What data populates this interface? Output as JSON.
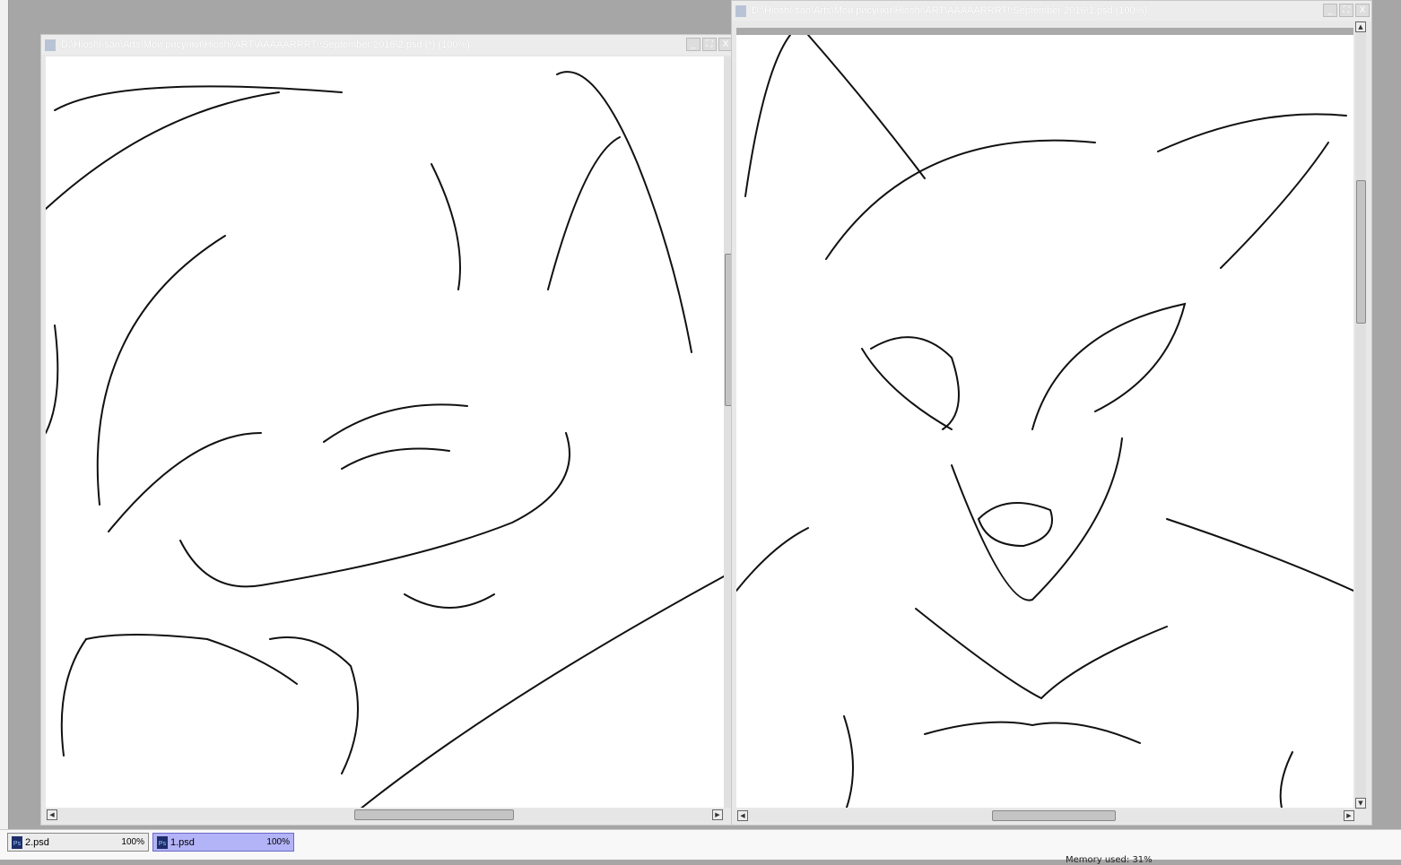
{
  "windows": [
    {
      "title": "D:\\Hioshi-san\\Arts\\Мои рисунки\\Hioshi\\ART\\AAAAARRRT!\\September 2016\\2.psd (*) (100%)"
    },
    {
      "title": "D:\\Hioshi-san\\Arts\\Мои рисунки\\Hioshi\\ART\\AAAAARRRT!\\September 2016\\1.psd (100%)"
    }
  ],
  "window_buttons": {
    "minimize": "_",
    "maximize": "⛶",
    "close": "X"
  },
  "taskbar": {
    "tabs": [
      {
        "label": "2.psd",
        "zoom": "100%",
        "active": false
      },
      {
        "label": "1.psd",
        "zoom": "100%",
        "active": true
      }
    ],
    "status": "Memory used: 31%",
    "colors": {
      "active_tab": "#b3b3f7",
      "inactive_tab": "#ececec"
    }
  }
}
